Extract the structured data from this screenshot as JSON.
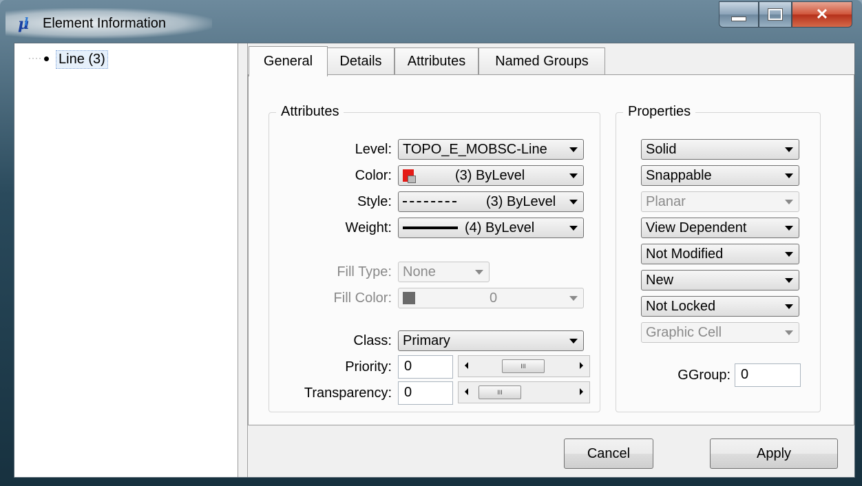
{
  "window": {
    "title": "Element Information"
  },
  "tree": {
    "items": [
      {
        "label": "Line (3)"
      }
    ]
  },
  "tabs": [
    {
      "label": "General"
    },
    {
      "label": "Details"
    },
    {
      "label": "Attributes"
    },
    {
      "label": "Named Groups"
    }
  ],
  "attributes": {
    "title": "Attributes",
    "level": {
      "label": "Level:",
      "value": "TOPO_E_MOBSC-Line"
    },
    "color": {
      "label": "Color:",
      "value": "(3) ByLevel"
    },
    "style": {
      "label": "Style:",
      "value": "(3) ByLevel"
    },
    "weight": {
      "label": "Weight:",
      "value": "(4) ByLevel"
    },
    "fill_type": {
      "label": "Fill Type:",
      "value": "None"
    },
    "fill_color": {
      "label": "Fill Color:",
      "value": "0"
    },
    "class": {
      "label": "Class:",
      "value": "Primary"
    },
    "priority": {
      "label": "Priority:",
      "value": "0",
      "thumb_glyph": "III"
    },
    "transparency": {
      "label": "Transparency:",
      "value": "0",
      "thumb_glyph": "III"
    }
  },
  "properties": {
    "title": "Properties",
    "solid": "Solid",
    "snappable": "Snappable",
    "planar": "Planar",
    "view_dependent": "View Dependent",
    "modified": "Not Modified",
    "new": "New",
    "locked": "Not Locked",
    "graphic_cell": "Graphic Cell",
    "ggroup": {
      "label": "GGroup:",
      "value": "0"
    }
  },
  "buttons": {
    "cancel": "Cancel",
    "apply": "Apply"
  },
  "colors": {
    "color_swatch": "#e41b17",
    "fill_swatch": "#6a6a6a",
    "tree_selection": "#e6f0fb"
  }
}
